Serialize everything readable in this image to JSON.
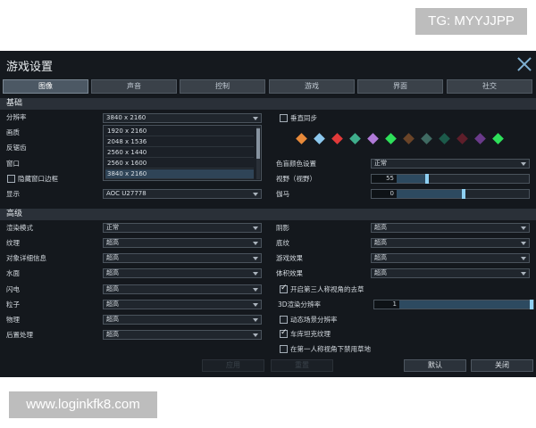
{
  "watermark_tg": "TG: MYYJJPP",
  "watermark_url": "www.loginkfk8.com",
  "window_title": "游戏设置",
  "tabs": [
    "图像",
    "声音",
    "控制",
    "游戏",
    "界面",
    "社交"
  ],
  "sections": {
    "basic": "基础",
    "advanced": "高级"
  },
  "basic": {
    "resolution_label": "分辨率",
    "resolution_value": "3840 x 2160",
    "resolution_options": [
      "1920 x 2160",
      "2048 x 1536",
      "2560 x 1440",
      "2560 x 1600",
      "3840 x 2160"
    ],
    "quality_label": "画质",
    "antialias_label": "反锯齿",
    "window_label": "窗口",
    "borderless_label": "隐藏窗口边框",
    "display_label": "显示",
    "display_value": "AOC U27778",
    "vsync_label": "垂直同步",
    "color_label": "色盲颜色设置",
    "color_value": "正常",
    "fov_label": "视野（视野）",
    "fov_value": "55",
    "gamma_label": "伽马",
    "gamma_value": "0"
  },
  "gems": [
    {
      "color": "#e88a3a"
    },
    {
      "color": "#8cc8ee"
    },
    {
      "color": "#e23a3a"
    },
    {
      "color": "#3fae8c"
    },
    {
      "color": "#b07ad8"
    },
    {
      "color": "#2ee05a"
    },
    {
      "color": "#6a4428"
    },
    {
      "color": "#3f6a62"
    },
    {
      "color": "#1c5a4a"
    },
    {
      "color": "#5e1e2a"
    },
    {
      "color": "#6a3a8a"
    },
    {
      "color": "#2ee05a"
    }
  ],
  "advanced": {
    "left": [
      {
        "label": "渲染模式",
        "value": "正常"
      },
      {
        "label": "纹理",
        "value": "超高"
      },
      {
        "label": "对象详细信息",
        "value": "超高"
      },
      {
        "label": "水面",
        "value": "超高"
      },
      {
        "label": "闪电",
        "value": "超高"
      },
      {
        "label": "粒子",
        "value": "超高"
      },
      {
        "label": "物理",
        "value": "超高"
      },
      {
        "label": "后置处理",
        "value": "超高"
      }
    ],
    "right": [
      {
        "label": "阴影",
        "value": "超高"
      },
      {
        "label": "底纹",
        "value": "超高"
      },
      {
        "label": "游戏效果",
        "value": "超高"
      },
      {
        "label": "体积效果",
        "value": "超高"
      }
    ],
    "third_person_label": "开启第三人称视角的去草",
    "render_res_label": "3D渲染分辨率",
    "render_res_value": "1",
    "dynamic_res_label": "动态场景分辨率",
    "garage_label": "车库坦克纹理",
    "first_person_label": "在第一人称视角下禁用草地"
  },
  "buttons": {
    "apply": "应用",
    "reset": "重置",
    "default": "默认",
    "close": "关闭"
  }
}
